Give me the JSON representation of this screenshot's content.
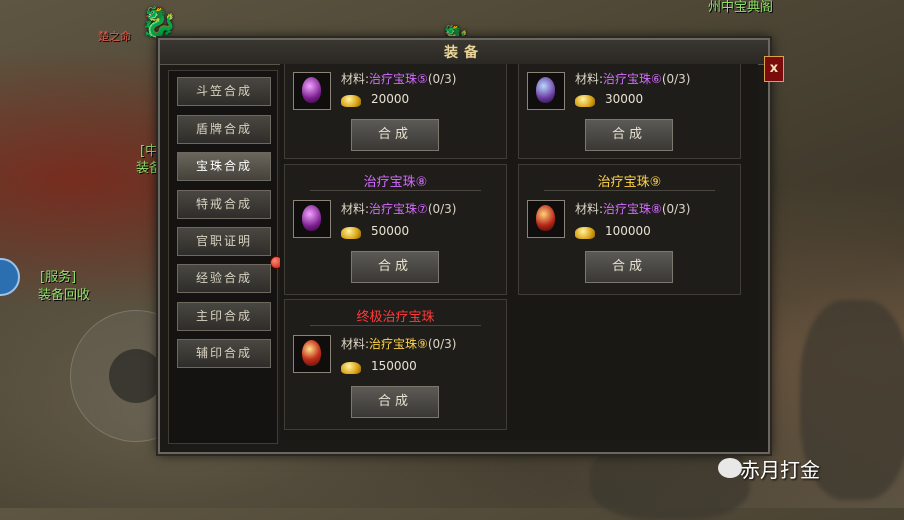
{
  "background": {
    "labels": [
      {
        "text": "[服务]",
        "color": "#8fe06a"
      },
      {
        "text": "装备回收",
        "color": "#8fe06a"
      },
      {
        "text": "楚之命",
        "color": "#e05a4a"
      },
      {
        "text": "[中",
        "color": "#8fe06a"
      },
      {
        "text": "装备",
        "color": "#8fe06a"
      },
      {
        "text": "州中宝典阁",
        "color": "#8fe06a"
      }
    ]
  },
  "window": {
    "title": "装备",
    "close_label": "x"
  },
  "sidebar": {
    "items": [
      {
        "label": "斗笠合成",
        "active": false
      },
      {
        "label": "盾牌合成",
        "active": false
      },
      {
        "label": "宝珠合成",
        "active": true
      },
      {
        "label": "特戒合成",
        "active": false
      },
      {
        "label": "官职证明",
        "active": false,
        "badge": "red-dot"
      },
      {
        "label": "经验合成",
        "active": false
      },
      {
        "label": "主印合成",
        "active": false
      },
      {
        "label": "辅印合成",
        "active": false
      }
    ]
  },
  "cards": [
    {
      "title": "",
      "title_color": "purple",
      "gem_icon": "purple-gem-icon",
      "material_label": "材料:",
      "material_name": "治疗宝珠⑤",
      "material_color": "purple",
      "material_count": "(0/3)",
      "price": "20000",
      "button": "合成"
    },
    {
      "title": "",
      "title_color": "gold",
      "gem_icon": "blue-gem-icon",
      "material_label": "材料:",
      "material_name": "治疗宝珠⑥",
      "material_color": "purple",
      "material_count": "(0/3)",
      "price": "30000",
      "button": "合成"
    },
    {
      "title": "治疗宝珠⑧",
      "title_color": "purple",
      "gem_icon": "purple-gem-icon",
      "material_label": "材料:",
      "material_name": "治疗宝珠⑦",
      "material_color": "purple",
      "material_count": "(0/3)",
      "price": "50000",
      "button": "合成"
    },
    {
      "title": "治疗宝珠⑨",
      "title_color": "gold",
      "gem_icon": "fire-gem-icon",
      "material_label": "材料:",
      "material_name": "治疗宝珠⑧",
      "material_color": "purple",
      "material_count": "(0/3)",
      "price": "100000",
      "button": "合成"
    },
    {
      "title": "终极治疗宝珠",
      "title_color": "red",
      "gem_icon": "ultimate-gem-icon",
      "material_label": "材料:",
      "material_name": "治疗宝珠⑨",
      "material_color": "gold",
      "material_count": "(0/3)",
      "price": "150000",
      "button": "合成"
    }
  ],
  "watermark": {
    "text": "赤月打金"
  },
  "colors": {
    "purple": "#d36bff",
    "gold": "#ffd34a",
    "red": "#ff3b3b"
  }
}
